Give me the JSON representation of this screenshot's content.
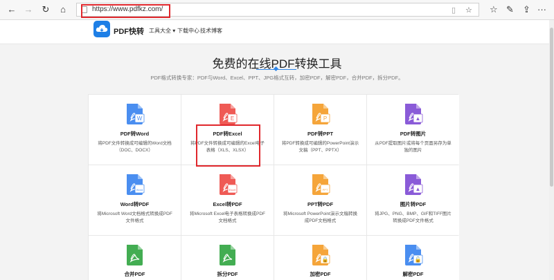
{
  "browser": {
    "url": "https://www.pdfkz.com/",
    "back_glyph": "←",
    "forward_glyph": "→",
    "refresh_glyph": "↻",
    "home_glyph": "⌂",
    "reading_glyph": "▯",
    "favorite_glyph": "☆",
    "favorites_glyph": "☆",
    "pen_glyph": "✎",
    "share_glyph": "⇪",
    "more_glyph": "···"
  },
  "site": {
    "logo_text": "PDF快转",
    "nav": [
      "工具大全 ▾",
      "下载中心",
      "技术博客"
    ]
  },
  "hero": {
    "title": "免费的在线PDF转换工具",
    "subtitle": "PDF格式转换专家：PDF与Word、Excel、PPT、JPG格式互转，加密PDF，解密PDF，合并PDF，拆分PDF。"
  },
  "tools": [
    {
      "name": "PDF转Word",
      "desc": "将PDF文件转换成可编辑的Word文档（DOC、DOCX）",
      "color": "#4a8ef0",
      "badge": "W"
    },
    {
      "name": "PDF转Excel",
      "desc": "将PDF文件转换成可编辑的Excel电子表格（XLS、XLSX）",
      "color": "#ef5a55",
      "badge": "E"
    },
    {
      "name": "PDF转PPT",
      "desc": "将PDF转换成可编辑的PowerPoint演示文稿（PPT、PPTX）",
      "color": "#f5a53a",
      "badge": "P"
    },
    {
      "name": "PDF转图片",
      "desc": "从PDF提取图片或将每个页面另存为单独的图片",
      "color": "#8a5bd8",
      "badge": "▲"
    },
    {
      "name": "Word转PDF",
      "desc": "将Microsoft Word文档格式转换成PDF文件格式",
      "color": "#4a8ef0",
      "badge": "Word"
    },
    {
      "name": "Excel转PDF",
      "desc": "将Microsoft Excel电子表格转换成PDF文档格式",
      "color": "#ef5a55",
      "badge": "Excel"
    },
    {
      "name": "PPT转PDF",
      "desc": "将Microsoft PowerPoint演示文稿转换成PDF文档格式",
      "color": "#f5a53a",
      "badge": "PPT"
    },
    {
      "name": "图片转PDF",
      "desc": "将JPG、PNG、BMP、GIF和TIFF图片转换成PDF文件格式",
      "color": "#8a5bd8",
      "badge": "▲"
    },
    {
      "name": "合并PDF",
      "desc": "",
      "color": "#43ad52",
      "badge": ""
    },
    {
      "name": "拆分PDF",
      "desc": "",
      "color": "#43ad52",
      "badge": ""
    },
    {
      "name": "加密PDF",
      "desc": "",
      "color": "#f5a53a",
      "badge": "🔒"
    },
    {
      "name": "解密PDF",
      "desc": "",
      "color": "#4a8ef0",
      "badge": "🔓"
    }
  ],
  "colors": {
    "highlight": "#e0262b",
    "brand": "#1e7fe6"
  }
}
